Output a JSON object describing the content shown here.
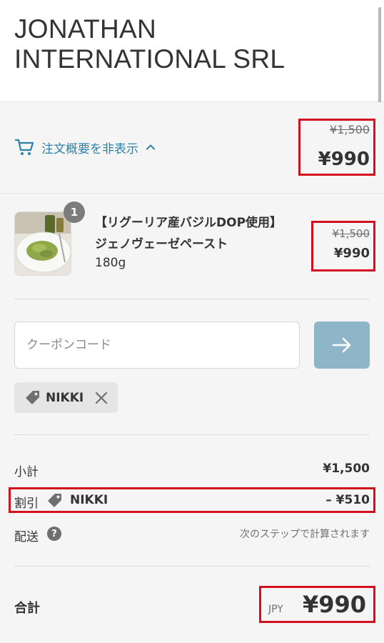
{
  "store": {
    "name": "JONATHAN INTERNATIONAL SRL"
  },
  "summary_toggle": {
    "label": "注文概要を非表示",
    "icon": "cart-icon",
    "chevron_icon": "chevron-up-icon",
    "original_price": "¥1,500",
    "price": "¥990",
    "link_color": "#2b83a6"
  },
  "line_item": {
    "quantity": "1",
    "title": "【リグーリア産バジルDOP使用】 ジェノヴェーゼペースト",
    "variant": "180g",
    "original_price": "¥1,500",
    "price": "¥990",
    "image_icon": "pasta-photo"
  },
  "coupon": {
    "placeholder": "クーポンコード",
    "value": "",
    "apply_icon": "arrow-right-icon",
    "button_color": "#8fb5c9"
  },
  "applied_discount": {
    "code": "NIKKI",
    "tag_icon": "tag-icon",
    "remove_icon": "close-icon"
  },
  "totals": {
    "subtotal_label": "小計",
    "subtotal_value": "¥1,500",
    "discount_label": "割引",
    "discount_code": "NIKKI",
    "discount_value": "– ¥510",
    "shipping_label": "配送",
    "shipping_help_icon": "question-icon",
    "shipping_value": "次のステップで計算されます",
    "total_label": "合計",
    "currency": "JPY",
    "total_value": "¥990"
  },
  "annotation_color": "#d31020"
}
